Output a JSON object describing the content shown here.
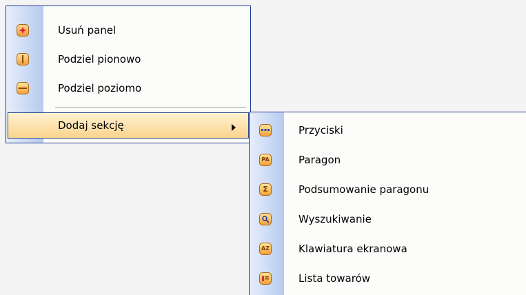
{
  "context_menu": {
    "items": [
      {
        "label": "Usuń panel",
        "icon": "remove-panel-icon"
      },
      {
        "label": "Podziel pionowo",
        "icon": "split-vertical-icon"
      },
      {
        "label": "Podziel poziomo",
        "icon": "split-horizontal-icon"
      },
      {
        "label": "Dodaj sekcję",
        "icon": "",
        "has_submenu": true
      }
    ]
  },
  "submenu": {
    "items": [
      {
        "label": "Przyciski",
        "icon": "buttons-icon"
      },
      {
        "label": "Paragon",
        "icon": "receipt-icon",
        "icon_text": "PA"
      },
      {
        "label": "Podsumowanie paragonu",
        "icon": "sum-icon",
        "icon_text": "Σ"
      },
      {
        "label": "Wyszukiwanie",
        "icon": "search-icon"
      },
      {
        "label": "Klawiatura ekranowa",
        "icon": "keyboard-icon",
        "icon_text": "AZ"
      },
      {
        "label": "Lista towarów",
        "icon": "product-list-icon"
      }
    ]
  },
  "colors": {
    "menu_border": "#1c3a8c",
    "highlight": "#fbd48e",
    "gutter": "#b6cbef"
  }
}
